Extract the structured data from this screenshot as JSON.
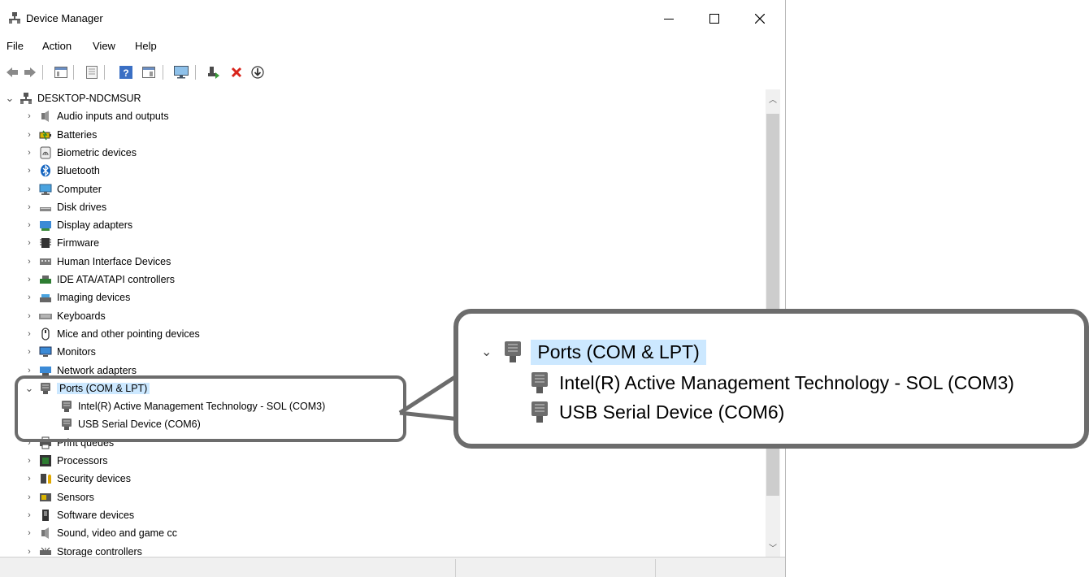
{
  "window": {
    "title": "Device Manager"
  },
  "menu": [
    "File",
    "Action",
    "View",
    "Help"
  ],
  "computer_name": "DESKTOP-NDCMSUR",
  "categories": [
    "Audio inputs and outputs",
    "Batteries",
    "Biometric devices",
    "Bluetooth",
    "Computer",
    "Disk drives",
    "Display adapters",
    "Firmware",
    "Human Interface Devices",
    "IDE ATA/ATAPI controllers",
    "Imaging devices",
    "Keyboards",
    "Mice and other pointing devices",
    "Monitors",
    "Network adapters",
    "Ports (COM & LPT)",
    "Print queues",
    "Processors",
    "Security devices",
    "Sensors",
    "Software devices",
    "Sound, video and game cc",
    "Storage controllers"
  ],
  "ports": {
    "label": "Ports (COM & LPT)",
    "children": [
      "Intel(R) Active Management Technology - SOL (COM3)",
      "USB Serial Device (COM6)"
    ]
  },
  "callout": {
    "label": "Ports (COM & LPT)",
    "children": [
      "Intel(R) Active Management Technology - SOL (COM3)",
      "USB Serial Device (COM6)"
    ]
  },
  "colors": {
    "selection": "#cce8ff",
    "callout_border": "#6c6c6c"
  }
}
